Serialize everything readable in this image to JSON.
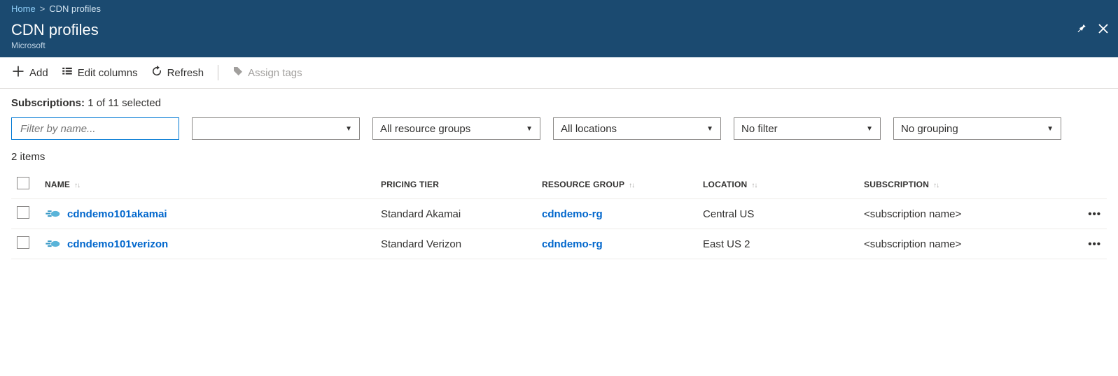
{
  "breadcrumb": {
    "home": "Home",
    "current": "CDN profiles"
  },
  "header": {
    "title": "CDN profiles",
    "subtitle": "Microsoft"
  },
  "toolbar": {
    "add": "Add",
    "edit_columns": "Edit columns",
    "refresh": "Refresh",
    "assign_tags": "Assign tags"
  },
  "subscriptions": {
    "label": "Subscriptions:",
    "value": "1 of 11 selected"
  },
  "filters": {
    "name_placeholder": "Filter by name...",
    "subscription": "",
    "resource_group": "All resource groups",
    "location": "All locations",
    "tag": "No filter",
    "grouping": "No grouping"
  },
  "count_text": "2 items",
  "columns": {
    "name": "Name",
    "pricing_tier": "Pricing tier",
    "resource_group": "Resource group",
    "location": "Location",
    "subscription": "Subscription"
  },
  "rows": [
    {
      "name": "cdndemo101akamai",
      "pricing_tier": "Standard Akamai",
      "resource_group": "cdndemo-rg",
      "location": "Central US",
      "subscription": "<subscription name>"
    },
    {
      "name": "cdndemo101verizon",
      "pricing_tier": "Standard Verizon",
      "resource_group": "cdndemo-rg",
      "location": "East US 2",
      "subscription": "<subscription name>"
    }
  ]
}
